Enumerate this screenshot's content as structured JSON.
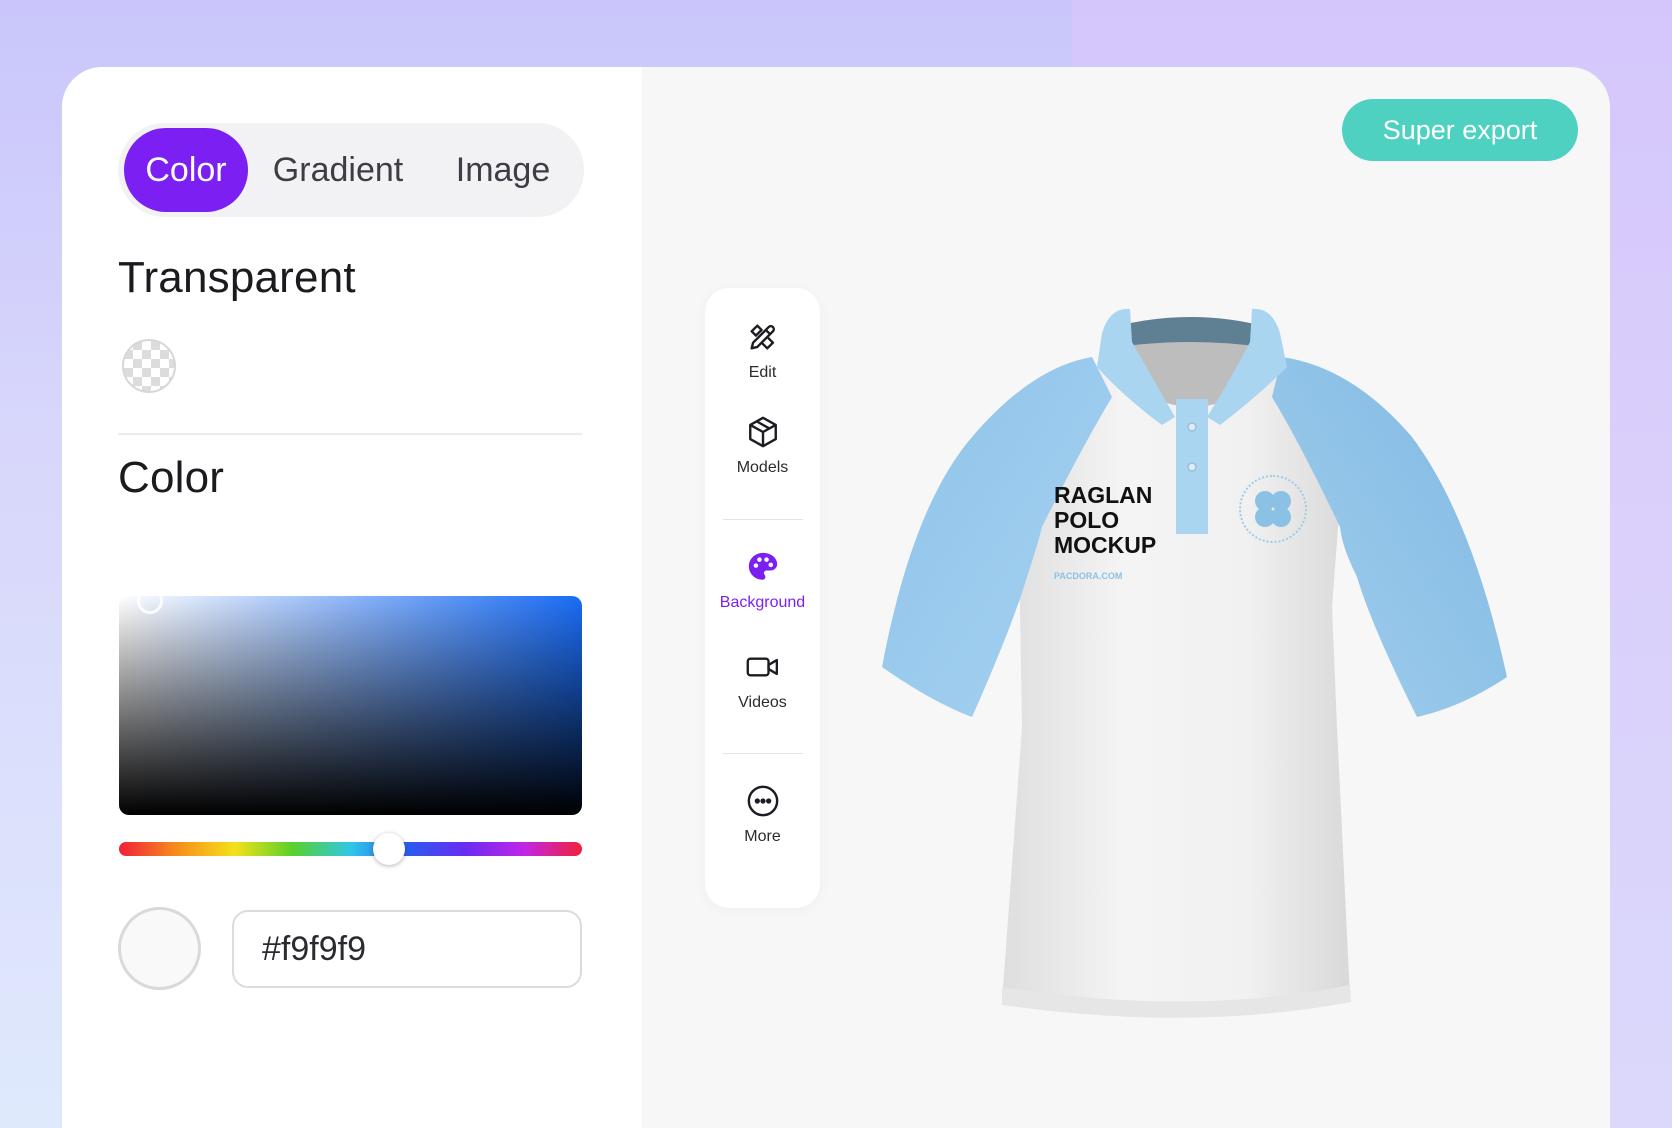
{
  "tabs": {
    "items": [
      "Color",
      "Gradient",
      "Image"
    ],
    "active": "Color"
  },
  "sections": {
    "transparent_label": "Transparent",
    "color_label": "Color"
  },
  "color_picker": {
    "hex_value": "#f9f9f9",
    "hue_position": 0.585,
    "base_hue_color": "#1a6cf5"
  },
  "toolbar": {
    "items": [
      {
        "label": "Edit",
        "icon": "edit-tools-icon"
      },
      {
        "label": "Models",
        "icon": "cube-icon"
      },
      {
        "label": "Background",
        "icon": "palette-icon",
        "active": true
      },
      {
        "label": "Videos",
        "icon": "video-camera-icon"
      },
      {
        "label": "More",
        "icon": "more-dots-icon"
      }
    ]
  },
  "header": {
    "export_label": "Super export"
  },
  "mockup": {
    "text_lines": [
      "RAGLAN",
      "POLO",
      "MOCKUP"
    ],
    "site_text": "PACDORA.COM"
  },
  "colors": {
    "accent": "#7b1ff2",
    "export": "#4fd1c1",
    "sleeve": "#9fcdee"
  }
}
